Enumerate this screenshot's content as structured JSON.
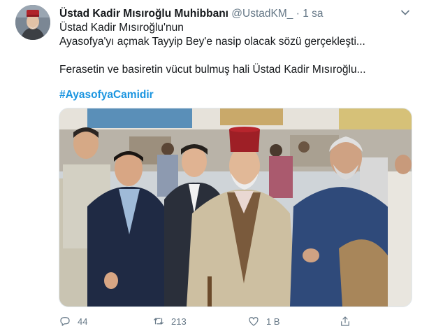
{
  "tweet": {
    "author_name": "Üstad Kadir Mısıroğlu Muhibbanı",
    "handle": "@UstadKM_",
    "separator": "·",
    "time": "1 sa",
    "lines": [
      "Üstad Kadir Mısıroğlu'nun",
      "Ayasofya'yı açmak Tayyip Bey'e nasip olacak sözü gerçekleşti...",
      "Ferasetin ve basiretin vücut bulmuş hali Üstad Kadir Mısıroğlu..."
    ],
    "hashtag": "#AyasofyaCamidir"
  },
  "actions": {
    "reply_count": "44",
    "retweet_count": "213",
    "like_count": "1 B"
  },
  "icons": {
    "caret": "chevron-down-icon",
    "reply": "reply-icon",
    "retweet": "retweet-icon",
    "like": "heart-icon",
    "share": "share-icon"
  },
  "colors": {
    "link": "#1b95e0",
    "secondary_text": "#657786",
    "primary_text": "#14171a"
  }
}
